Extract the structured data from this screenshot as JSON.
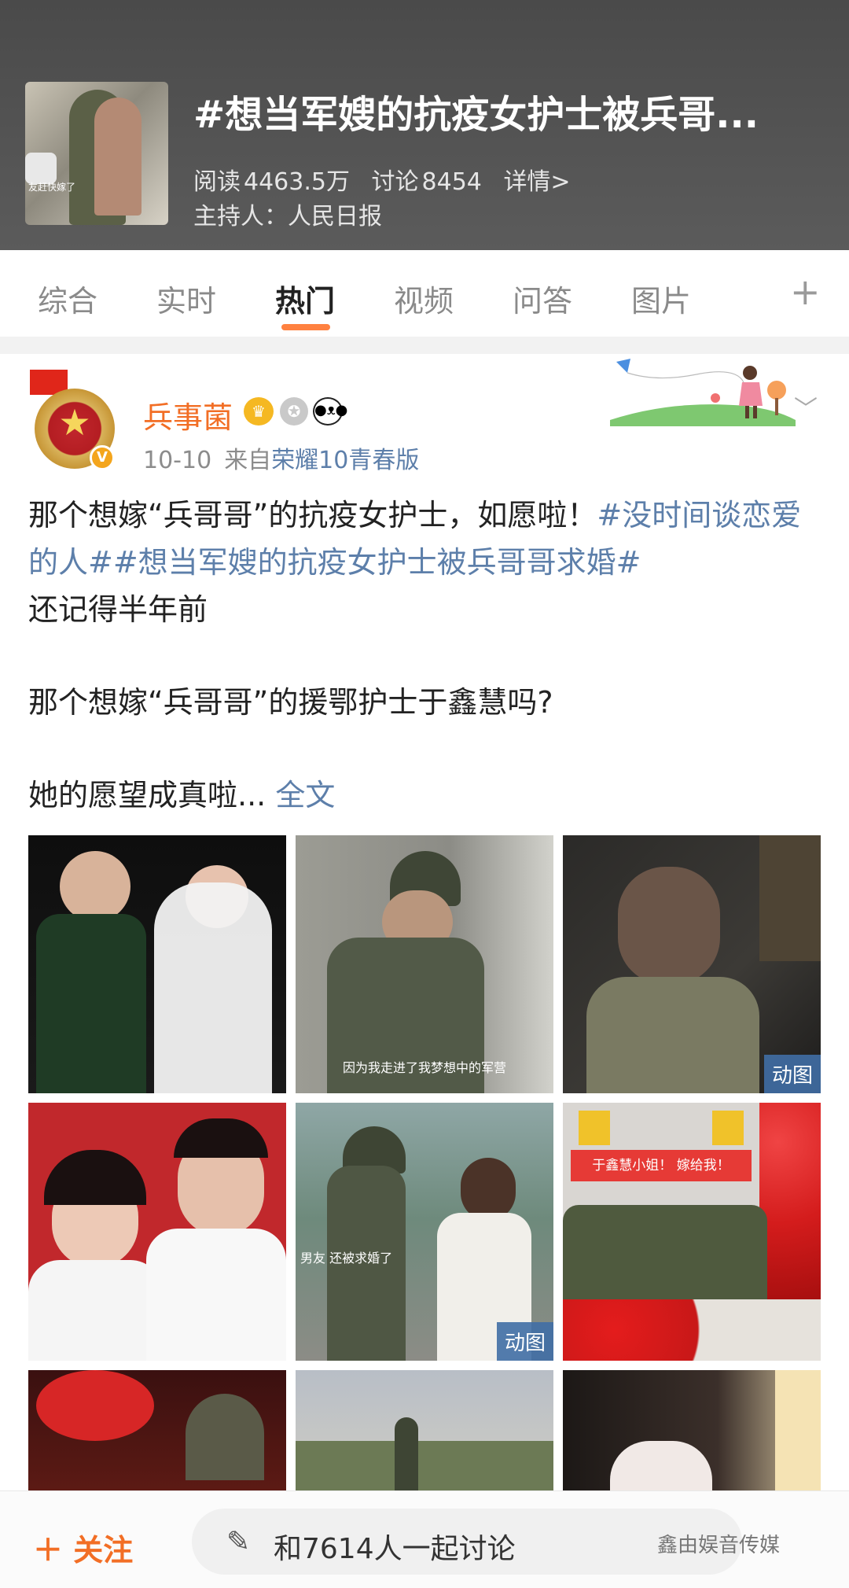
{
  "topic": {
    "title": "#想当军嫂的抗疫女护士被兵哥...",
    "read_label": "阅读",
    "read_count": "4463.5万",
    "discuss_label": "讨论",
    "discuss_count": "8454",
    "details_link": "详情>",
    "host_label": "主持人：",
    "host_name": "人民日报",
    "thumb_caption": "友赶快嫁了"
  },
  "tabs": [
    {
      "label": "综合"
    },
    {
      "label": "实时"
    },
    {
      "label": "热门",
      "active": true
    },
    {
      "label": "视频"
    },
    {
      "label": "问答"
    },
    {
      "label": "图片"
    }
  ],
  "tab_plus": "+",
  "post": {
    "author": "兵事菌",
    "date": "10-10",
    "via": "来自",
    "device": "荣耀10青春版",
    "line1_plain": "那个想嫁“兵哥哥”的抗疫女护士，如愿啦！",
    "tag1": "#没时间谈恋爱的人#",
    "tag2": "#想当军嫂的抗疫女护士被兵哥哥求婚#",
    "line2": "还记得半年前",
    "line3": "那个想嫁“兵哥哥”的援鄂护士于鑫慧吗?",
    "line4": "她的愿望成真啦...",
    "full_text": "全文"
  },
  "images": {
    "caption_2": "因为我走进了我梦想中的军营",
    "caption_5": "男友 还被求婚了",
    "banner_6": "于鑫慧小姐！ 嫁给我！",
    "dongtu": "动图"
  },
  "bottom": {
    "follow": "＋ 关注",
    "discuss": "和7614人一起讨论",
    "watermark": "鑫由娱音传媒"
  },
  "colors": {
    "accent": "#f26e25",
    "link": "#5d7faa",
    "tab_indicator": "#ff8140"
  }
}
